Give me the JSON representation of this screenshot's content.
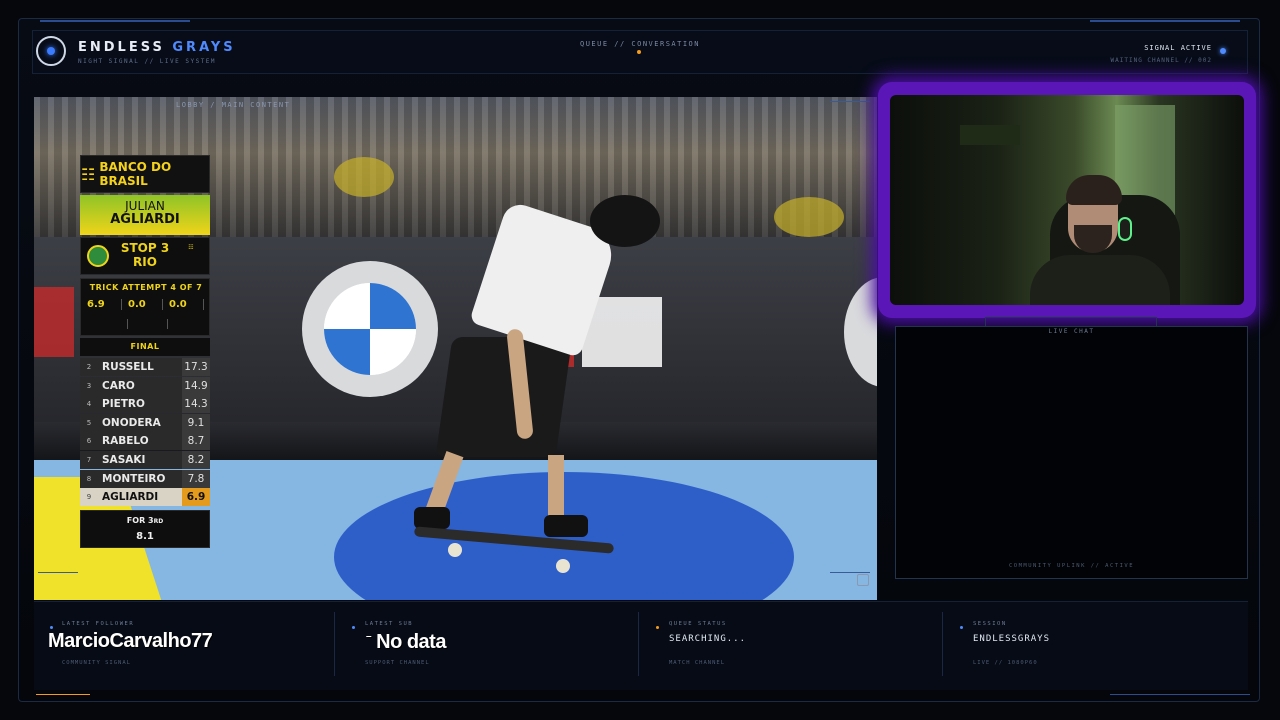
{
  "header": {
    "brand_primary": "ENDLESS",
    "brand_accent": "GRAYS",
    "brand_sub": "NIGHT SIGNAL // LIVE SYSTEM",
    "nav": "QUEUE // CONVERSATION",
    "signal_status": "SIGNAL ACTIVE",
    "waiting_channel": "WAITING CHANNEL // 002"
  },
  "main": {
    "label": "LOBBY / MAIN CONTENT"
  },
  "scoreboard": {
    "sponsor": "BANCO DO BRASIL",
    "skater_first": "JULIAN",
    "skater_last": "AGLIARDI",
    "event": "STOP 3 RIO",
    "trick_label": "TRICK ATTEMPT 4 OF 7",
    "trick_scores": [
      "6.9",
      "0.0",
      "0.0"
    ],
    "final_label": "FINAL",
    "standings": [
      {
        "rank": "2",
        "name": "RUSSELL",
        "score": "17.3"
      },
      {
        "rank": "3",
        "name": "CARO",
        "score": "14.9"
      },
      {
        "rank": "4",
        "name": "PIETRO",
        "score": "14.3"
      },
      {
        "rank": "5",
        "name": "ONODERA",
        "score": "9.1"
      },
      {
        "rank": "6",
        "name": "RABELO",
        "score": "8.7"
      },
      {
        "rank": "7",
        "name": "SASAKI",
        "score": "8.2"
      },
      {
        "rank": "8",
        "name": "MONTEIRO",
        "score": "7.8"
      },
      {
        "rank": "9",
        "name": "AGLIARDI",
        "score": "6.9",
        "highlight": true
      }
    ],
    "for_label": "FOR 3",
    "for_suffix": "RD",
    "for_value": "8.1"
  },
  "chat": {
    "title": "LIVE CHAT",
    "footer": "COMMUNITY UPLINK // ACTIVE"
  },
  "bottom": {
    "follower": {
      "label": "LATEST FOLLOWER",
      "value": "MarcioCarvalho77",
      "sub": "COMMUNITY SIGNAL"
    },
    "sub": {
      "label": "LATEST SUB",
      "value": "No data",
      "sub": "SUPPORT CHANNEL"
    },
    "queue": {
      "label": "QUEUE STATUS",
      "value": "SEARCHING...",
      "sub": "MATCH CHANNEL"
    },
    "session": {
      "label": "SESSION",
      "value": "ENDLESSGRAYS",
      "sub": "LIVE // 1080P60"
    }
  },
  "colors": {
    "accent_blue": "#4f8bff",
    "accent_orange": "#f59c1a",
    "webcam_glow": "#5b16b8",
    "scoreboard_yellow": "#f0d41a"
  },
  "icons": [
    "logo-ring-icon",
    "signal-dot-icon",
    "media-control-icon",
    "status-dot-icon"
  ]
}
